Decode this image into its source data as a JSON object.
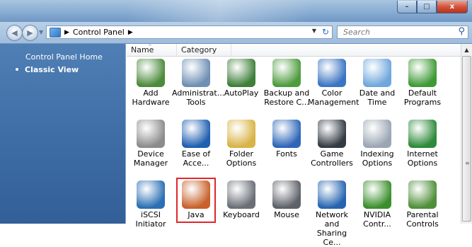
{
  "window": {
    "caption_buttons": [
      {
        "name": "minimize",
        "glyph": "–"
      },
      {
        "name": "maximize",
        "glyph": "□"
      },
      {
        "name": "close",
        "glyph": "x"
      }
    ]
  },
  "navbar": {
    "back_glyph": "◀",
    "forward_glyph": "▶",
    "breadcrumb": [
      "Control Panel"
    ],
    "breadcrumb_sep": "▶",
    "address_dropdown": "▼",
    "refresh_glyph": "↻",
    "search_placeholder": "Search",
    "search_icon": "⚲"
  },
  "leftpane": {
    "home_label": "Control Panel Home",
    "classic_label": "Classic View"
  },
  "content": {
    "columns": [
      "Name",
      "Category"
    ],
    "items": [
      {
        "name": "Add\nHardware",
        "icon": "add-hardware-icon",
        "color": "#4c8a3c"
      },
      {
        "name": "Administrat...\nTools",
        "icon": "administrative-tools-icon",
        "color": "#6e8fb3"
      },
      {
        "name": "AutoPlay",
        "icon": "autoplay-icon",
        "color": "#3f7f3a"
      },
      {
        "name": "Backup and\nRestore C...",
        "icon": "backup-restore-icon",
        "color": "#4e9b3e"
      },
      {
        "name": "Color\nManagement",
        "icon": "color-management-icon",
        "color": "#3b74c3"
      },
      {
        "name": "Date and\nTime",
        "icon": "date-time-icon",
        "color": "#6fa7dc"
      },
      {
        "name": "Default\nPrograms",
        "icon": "default-programs-icon",
        "color": "#3f9a36"
      },
      {
        "name": "Device\nManager",
        "icon": "device-manager-icon",
        "color": "#8c8c8c"
      },
      {
        "name": "Ease of\nAcce...",
        "icon": "ease-of-access-icon",
        "color": "#1f5fb0"
      },
      {
        "name": "Folder\nOptions",
        "icon": "folder-options-icon",
        "color": "#d9b347"
      },
      {
        "name": "Fonts",
        "icon": "fonts-icon",
        "color": "#2e66b8"
      },
      {
        "name": "Game\nControllers",
        "icon": "game-controllers-icon",
        "color": "#333b45"
      },
      {
        "name": "Indexing\nOptions",
        "icon": "indexing-options-icon",
        "color": "#9aa6b3"
      },
      {
        "name": "Internet\nOptions",
        "icon": "internet-options-icon",
        "color": "#2f8a3a"
      },
      {
        "name": "iSCSI Initiator",
        "icon": "iscsi-initiator-icon",
        "color": "#2b6fb4"
      },
      {
        "name": "Java",
        "icon": "java-icon",
        "color": "#c8612a",
        "selected": true
      },
      {
        "name": "Keyboard",
        "icon": "keyboard-icon",
        "color": "#6a6f76"
      },
      {
        "name": "Mouse",
        "icon": "mouse-icon",
        "color": "#5d6168"
      },
      {
        "name": "Network and\nSharing Ce...",
        "icon": "network-sharing-icon",
        "color": "#2664b0"
      },
      {
        "name": "NVIDIA\nContr...",
        "icon": "nvidia-control-icon",
        "color": "#3a8f2c"
      },
      {
        "name": "Parental\nControls",
        "icon": "parental-controls-icon",
        "color": "#4f8f3a"
      }
    ]
  },
  "scrollbar": {
    "up_glyph": "▲",
    "grip_glyph": "≡"
  }
}
